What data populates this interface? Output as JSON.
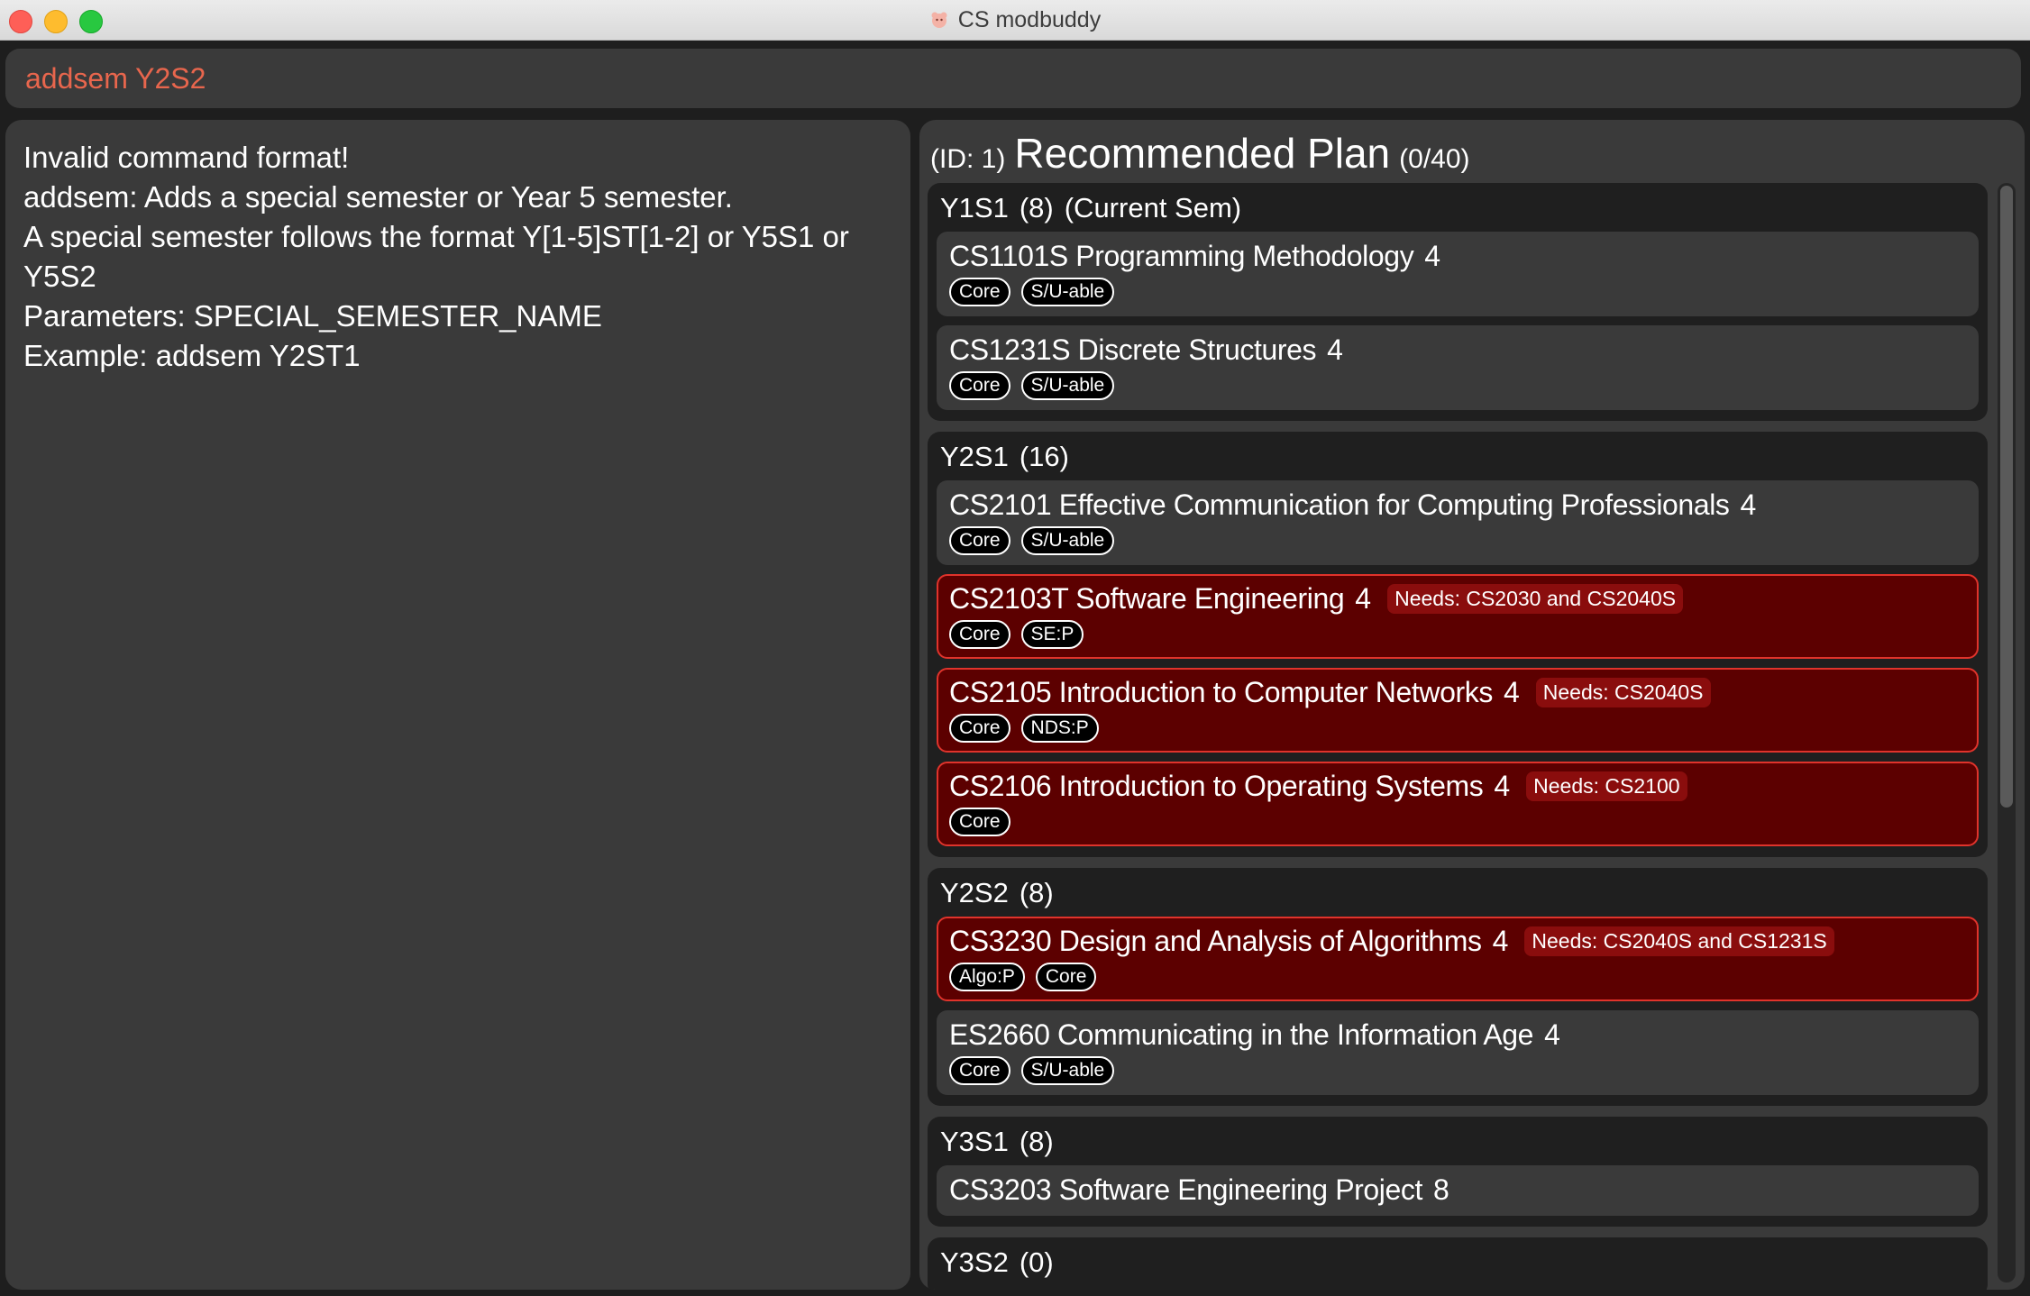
{
  "window": {
    "title": "CS modbuddy"
  },
  "command": {
    "value": "addsem Y2S2"
  },
  "result": {
    "lines": [
      "Invalid command format!",
      "addsem: Adds a special semester or Year 5 semester.",
      "A special semester follows the format Y[1-5]ST[1-2] or Y5S1 or",
      "Y5S2",
      "Parameters: SPECIAL_SEMESTER_NAME",
      "Example: addsem Y2ST1"
    ]
  },
  "plan": {
    "id_label": "(ID: 1)",
    "name": "Recommended Plan",
    "credits": "(0/40)",
    "semesters": [
      {
        "name": "Y1S1",
        "credits": "(8)",
        "note": "(Current Sem)",
        "modules": [
          {
            "title": "CS1101S Programming Methodology",
            "credits": "4",
            "needs": "",
            "tags": [
              "Core",
              "S/U-able"
            ],
            "error": false
          },
          {
            "title": "CS1231S Discrete Structures",
            "credits": "4",
            "needs": "",
            "tags": [
              "Core",
              "S/U-able"
            ],
            "error": false
          }
        ]
      },
      {
        "name": "Y2S1",
        "credits": "(16)",
        "note": "",
        "modules": [
          {
            "title": "CS2101 Effective Communication for Computing Professionals",
            "credits": "4",
            "needs": "",
            "tags": [
              "Core",
              "S/U-able"
            ],
            "error": false
          },
          {
            "title": "CS2103T Software Engineering",
            "credits": "4",
            "needs": "Needs: CS2030 and CS2040S",
            "tags": [
              "Core",
              "SE:P"
            ],
            "error": true
          },
          {
            "title": "CS2105 Introduction to Computer Networks",
            "credits": "4",
            "needs": "Needs: CS2040S",
            "tags": [
              "Core",
              "NDS:P"
            ],
            "error": true
          },
          {
            "title": "CS2106 Introduction to Operating Systems",
            "credits": "4",
            "needs": "Needs: CS2100",
            "tags": [
              "Core"
            ],
            "error": true
          }
        ]
      },
      {
        "name": "Y2S2",
        "credits": "(8)",
        "note": "",
        "modules": [
          {
            "title": "CS3230 Design and Analysis of Algorithms",
            "credits": "4",
            "needs": "Needs: CS2040S and CS1231S",
            "tags": [
              "Algo:P",
              "Core"
            ],
            "error": true
          },
          {
            "title": "ES2660 Communicating in the Information Age",
            "credits": "4",
            "needs": "",
            "tags": [
              "Core",
              "S/U-able"
            ],
            "error": false
          }
        ]
      },
      {
        "name": "Y3S1",
        "credits": "(8)",
        "note": "",
        "modules": [
          {
            "title": "CS3203 Software Engineering Project",
            "credits": "8",
            "needs": "",
            "tags": [],
            "error": false
          }
        ]
      },
      {
        "name": "Y3S2",
        "credits": "(0)",
        "note": "",
        "modules": []
      }
    ]
  },
  "colors": {
    "background": "#1e1e1e",
    "panel": "#3a3a3a",
    "semester_card": "#1f1f1f",
    "error_card": "#5c0000",
    "error_border": "#e0332b",
    "command_text": "#e8664d"
  },
  "icons": {
    "app": "app-icon",
    "window_close": "close-icon",
    "window_minimize": "minimize-icon",
    "window_zoom": "zoom-icon"
  }
}
